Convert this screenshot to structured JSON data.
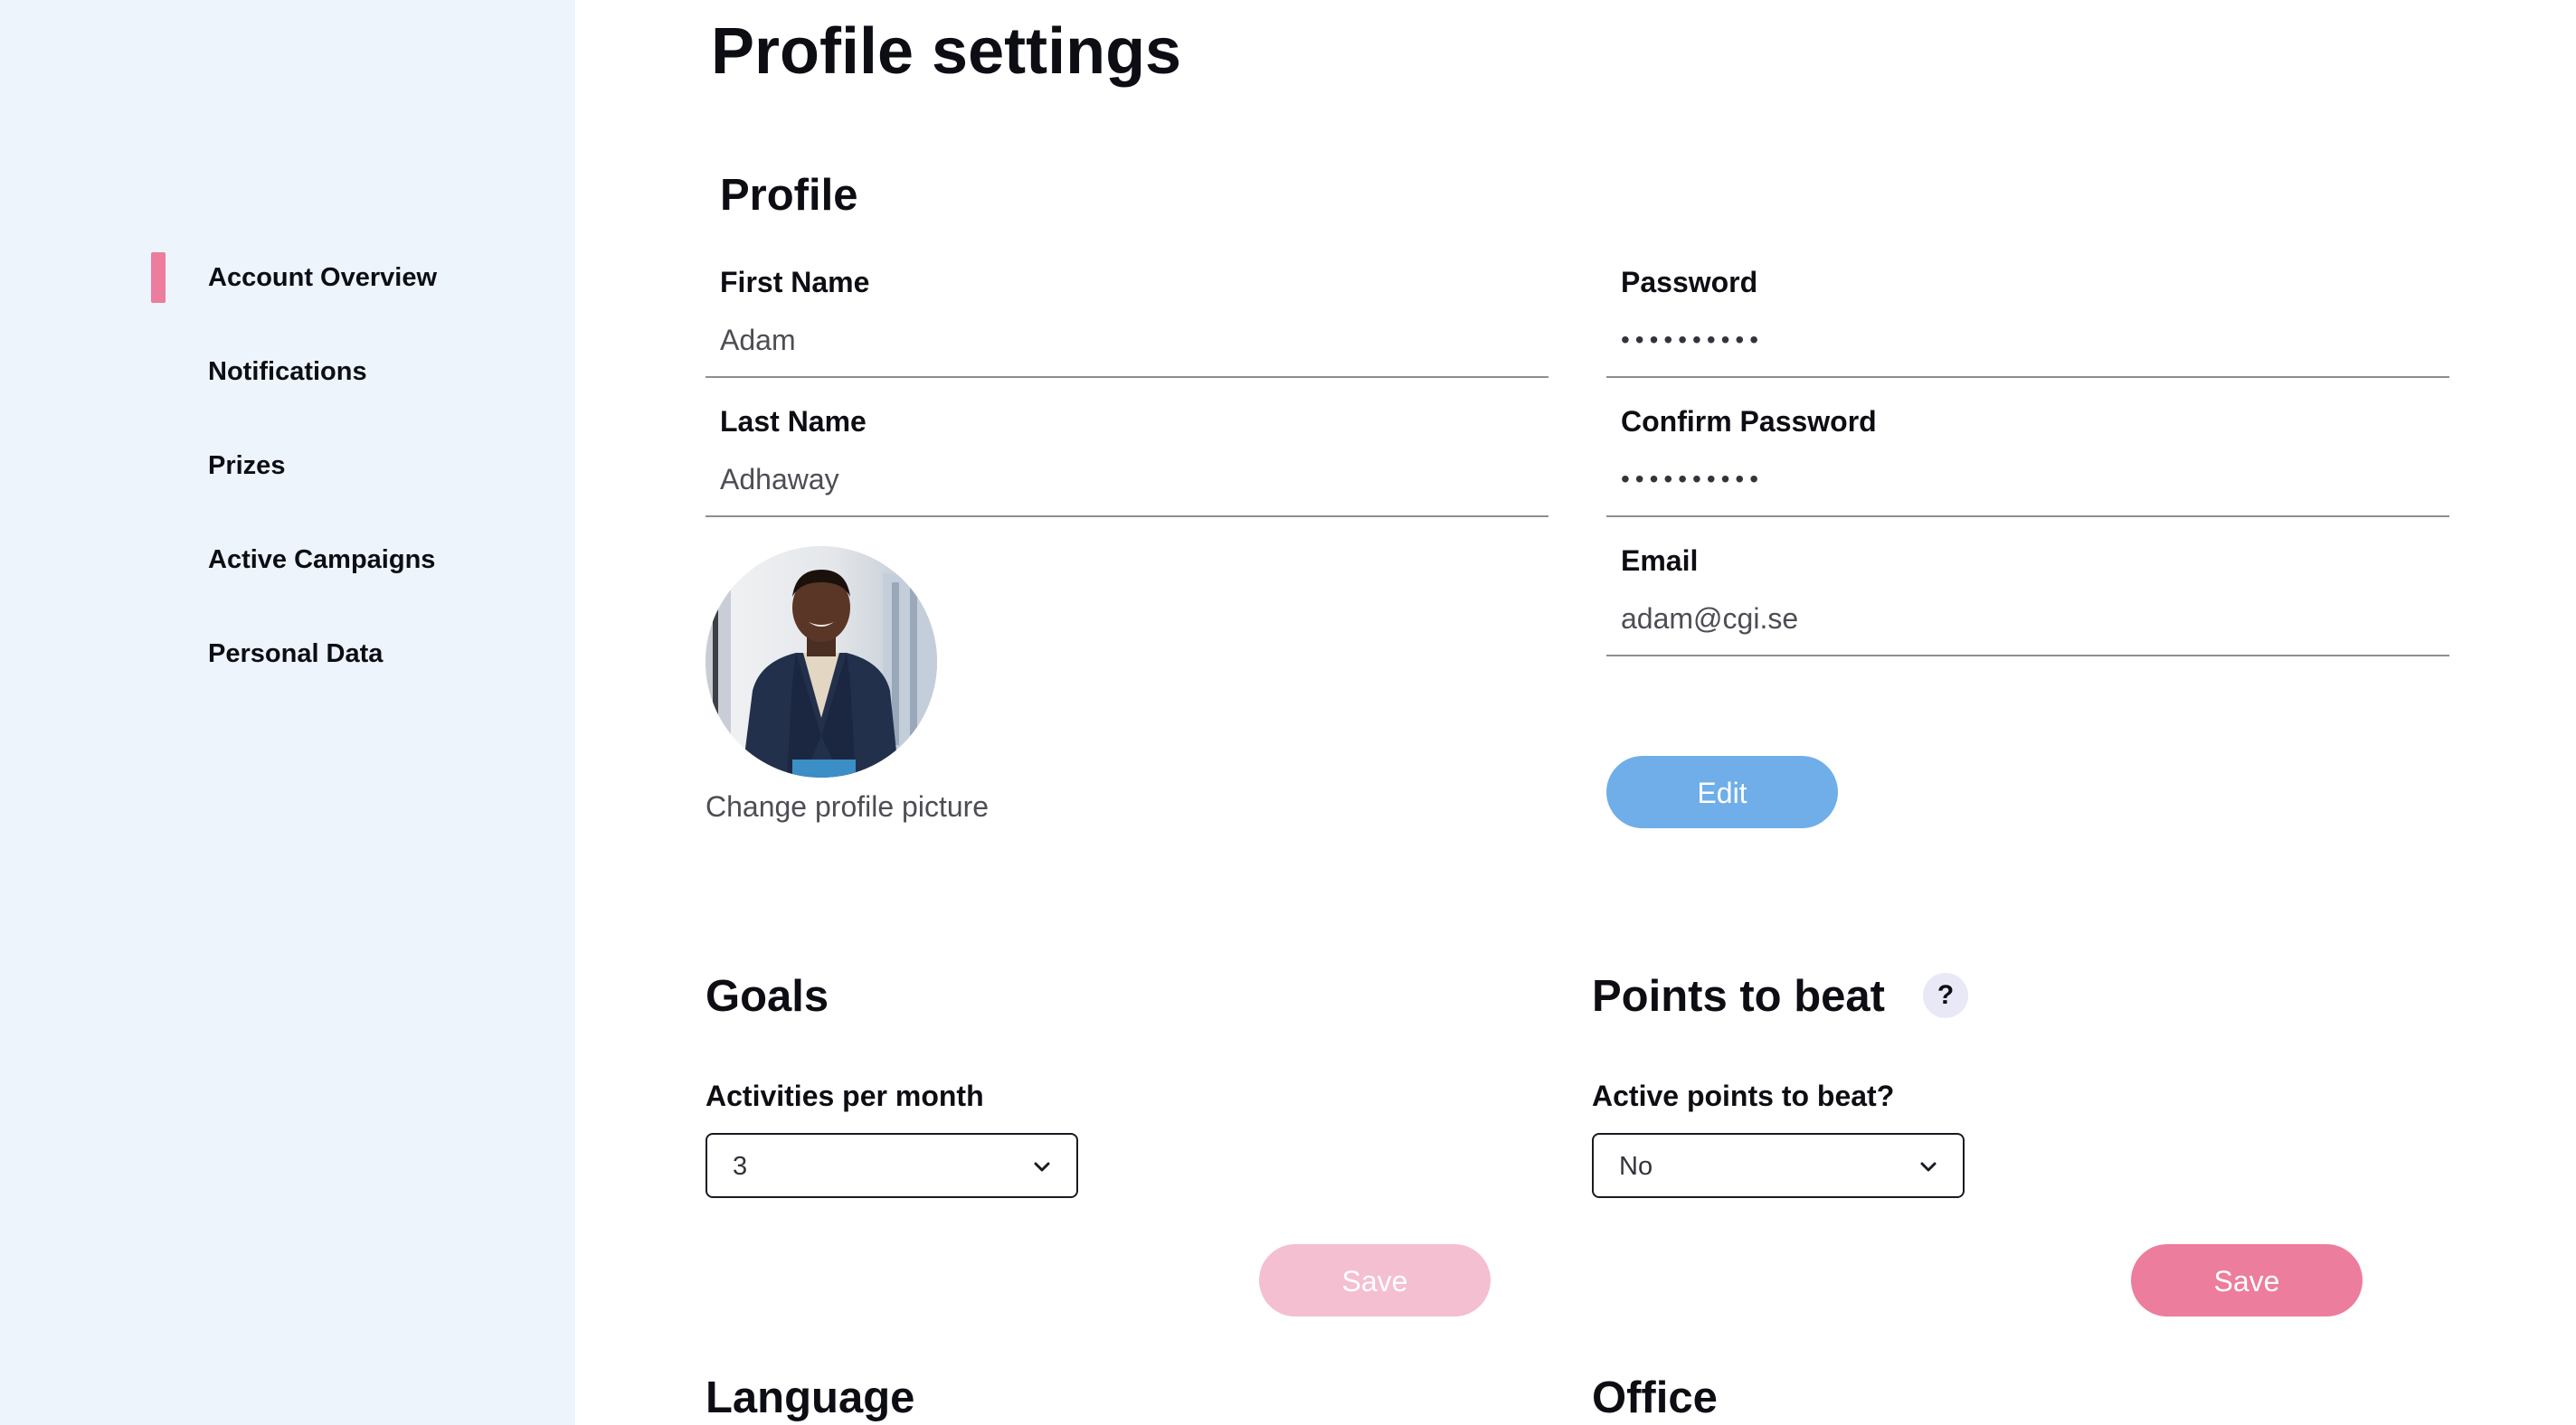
{
  "sidebar": {
    "items": [
      {
        "label": "Account Overview",
        "active": true
      },
      {
        "label": "Notifications"
      },
      {
        "label": "Prizes"
      },
      {
        "label": "Active Campaigns"
      },
      {
        "label": "Personal Data"
      }
    ]
  },
  "page": {
    "title": "Profile settings"
  },
  "profile": {
    "title": "Profile",
    "first_name": {
      "label": "First Name",
      "value": "Adam"
    },
    "last_name": {
      "label": "Last Name",
      "value": "Adhaway"
    },
    "password": {
      "label": "Password",
      "value": "••••••••••"
    },
    "confirm_password": {
      "label": "Confirm Password",
      "value": "••••••••••"
    },
    "email": {
      "label": "Email",
      "value": "adam@cgi.se"
    },
    "change_picture": "Change profile picture",
    "edit_button": "Edit"
  },
  "goals": {
    "title": "Goals",
    "activities_label": "Activities per month",
    "activities_value": "3",
    "save_button": "Save"
  },
  "points": {
    "title": "Points to beat",
    "help": "?",
    "active_label": "Active points to beat?",
    "active_value": "No",
    "save_button": "Save"
  },
  "language": {
    "title": "Language"
  },
  "office": {
    "title": "Office"
  },
  "colors": {
    "sidebar_bg": "#edf4fc",
    "accent_pink": "#ec7d9d",
    "edit_blue": "#6faee8",
    "disabled_pink": "#f4bfd0"
  }
}
